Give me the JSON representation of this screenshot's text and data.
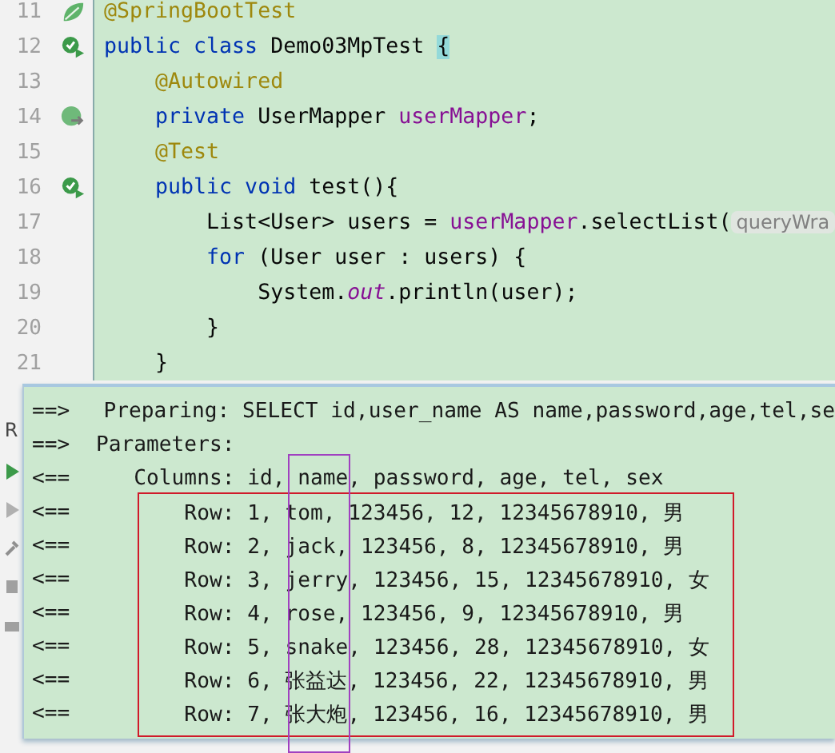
{
  "editor": {
    "lines": [
      {
        "number": "11",
        "kind": "bean",
        "tokens": [
          {
            "kind": "annotation",
            "text": "@SpringBootTest"
          }
        ]
      },
      {
        "number": "12",
        "kind": "run",
        "tokens": [
          {
            "kind": "keyword",
            "text": "public class "
          },
          {
            "kind": "plain",
            "text": "Demo03MpTest "
          },
          {
            "kind": "brace",
            "text": "{"
          }
        ]
      },
      {
        "number": "13",
        "tokens": [
          {
            "kind": "annotation",
            "text": "    @Autowired"
          }
        ]
      },
      {
        "number": "14",
        "kind": "autowired",
        "tokens": [
          {
            "kind": "keyword",
            "text": "    private "
          },
          {
            "kind": "plain",
            "text": "UserMapper "
          },
          {
            "kind": "field",
            "text": "userMapper"
          },
          {
            "kind": "plain",
            "text": ";"
          }
        ]
      },
      {
        "number": "15",
        "tokens": [
          {
            "kind": "annotation",
            "text": "    @Test"
          }
        ]
      },
      {
        "number": "16",
        "kind": "run",
        "tokens": [
          {
            "kind": "keyword",
            "text": "    public void "
          },
          {
            "kind": "plain",
            "text": "test(){"
          }
        ]
      },
      {
        "number": "17",
        "tokens": [
          {
            "kind": "plain",
            "text": "        List<User> users = "
          },
          {
            "kind": "field",
            "text": "userMapper"
          },
          {
            "kind": "plain",
            "text": ".selectList("
          },
          {
            "kind": "hint",
            "text": "queryWra"
          }
        ]
      },
      {
        "number": "18",
        "tokens": [
          {
            "kind": "keyword",
            "text": "        for "
          },
          {
            "kind": "plain",
            "text": "(User user : users) {"
          }
        ]
      },
      {
        "number": "19",
        "tokens": [
          {
            "kind": "plain",
            "text": "            System."
          },
          {
            "kind": "static",
            "text": "out"
          },
          {
            "kind": "plain",
            "text": ".println(user);"
          }
        ]
      },
      {
        "number": "20",
        "tokens": [
          {
            "kind": "plain",
            "text": "        }"
          }
        ]
      },
      {
        "number": "21",
        "tokens": [
          {
            "kind": "plain",
            "text": "    }"
          }
        ]
      }
    ]
  },
  "run_panel": {
    "tab_label": "R"
  },
  "console_popup": {
    "lines": [
      {
        "prefix": "==>",
        "text": " Preparing: SELECT id,user_name AS name,password,age,tel,se"
      },
      {
        "prefix": "==>",
        "text": "Parameters:"
      },
      {
        "prefix": "<==",
        "text": "   Columns: id, name, password, age, tel, sex"
      },
      {
        "prefix": "<==",
        "text": "       Row: 1, tom, 123456, 12, 12345678910, 男"
      },
      {
        "prefix": "<==",
        "text": "       Row: 2, jack, 123456, 8, 12345678910, 男"
      },
      {
        "prefix": "<==",
        "text": "       Row: 3, jerry, 123456, 15, 12345678910, 女"
      },
      {
        "prefix": "<==",
        "text": "       Row: 4, rose, 123456, 9, 12345678910, 男"
      },
      {
        "prefix": "<==",
        "text": "       Row: 5, snake, 123456, 28, 12345678910, 女"
      },
      {
        "prefix": "<==",
        "text": "       Row: 6, 张益达, 123456, 22, 12345678910, 男"
      },
      {
        "prefix": "<==",
        "text": "       Row: 7, 张大炮, 123456, 16, 12345678910, 男"
      }
    ]
  }
}
